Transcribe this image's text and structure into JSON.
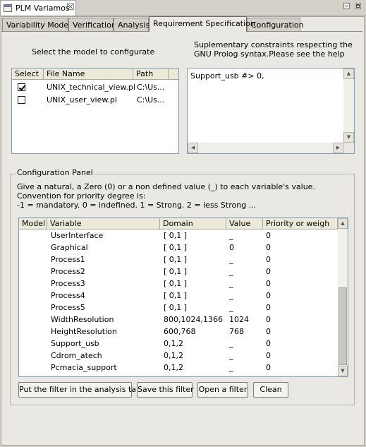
{
  "view": {
    "title": "PLM Variamos",
    "close_glyph": "☒"
  },
  "tabs": [
    {
      "label": "Variability Models"
    },
    {
      "label": "Verification"
    },
    {
      "label": "Analysis"
    },
    {
      "label": "Requirement Specification"
    },
    {
      "label": "Configuration"
    }
  ],
  "model_section": {
    "instruction": "Select the model to configurate",
    "headers": [
      "Select",
      "File Name",
      "Path"
    ],
    "rows": [
      {
        "checked": true,
        "file": "UNIX_technical_view.pl",
        "path": "C:\\Us..."
      },
      {
        "checked": false,
        "file": "UNIX_user_view.pl",
        "path": "C:\\Us..."
      }
    ]
  },
  "constraints": {
    "help_line1": "Suplementary constraints respecting the",
    "help_line2": "GNU Prolog syntax.Please see the help",
    "value": "Support_usb #> 0,"
  },
  "config_panel": {
    "title": "Configuration Panel",
    "info_line1": "Give a natural, a Zero (0) or a non defined value (_) to each variable's value.",
    "info_line2": "Convention for priority degree is:",
    "info_line3": "-1 = mandatory. 0 = indefined. 1 = Strong. 2 = less Strong ...",
    "headers": [
      "Model",
      "Variable",
      "Domain",
      "Value",
      "Priority or weigh"
    ],
    "rows": [
      {
        "model": "",
        "variable": "UserInterface",
        "domain": "[ 0,1 ]",
        "value": "_",
        "priority": "0"
      },
      {
        "model": "",
        "variable": "Graphical",
        "domain": "[ 0,1 ]",
        "value": "0",
        "priority": "0"
      },
      {
        "model": "",
        "variable": "Process1",
        "domain": "[ 0,1 ]",
        "value": "_",
        "priority": "0"
      },
      {
        "model": "",
        "variable": "Process2",
        "domain": "[ 0,1 ]",
        "value": "_",
        "priority": "0"
      },
      {
        "model": "",
        "variable": "Process3",
        "domain": "[ 0,1 ]",
        "value": "_",
        "priority": "0"
      },
      {
        "model": "",
        "variable": "Process4",
        "domain": "[ 0,1 ]",
        "value": "_",
        "priority": "0"
      },
      {
        "model": "",
        "variable": "Process5",
        "domain": "[ 0,1 ]",
        "value": "_",
        "priority": "0"
      },
      {
        "model": "",
        "variable": "WidthResolution",
        "domain": "800,1024,1366",
        "value": "1024",
        "priority": "0"
      },
      {
        "model": "",
        "variable": "HeightResolution",
        "domain": "600,768",
        "value": "768",
        "priority": "0"
      },
      {
        "model": "",
        "variable": "Support_usb",
        "domain": "0,1,2",
        "value": "_",
        "priority": "0"
      },
      {
        "model": "",
        "variable": "Cdrom_atech",
        "domain": "0,1,2",
        "value": "_",
        "priority": "0"
      },
      {
        "model": "",
        "variable": "Pcmacia_support",
        "domain": "0,1,2",
        "value": "_",
        "priority": "0"
      }
    ]
  },
  "buttons": {
    "put_filter": "Put the filter in the analysis tab",
    "save_filter": "Save this filter",
    "open_filter": "Open a filter",
    "clean": "Clean"
  },
  "colors": {
    "background": "#d4d0c8",
    "pane": "#e9e8e2",
    "border_blue": "#7f9db9"
  }
}
